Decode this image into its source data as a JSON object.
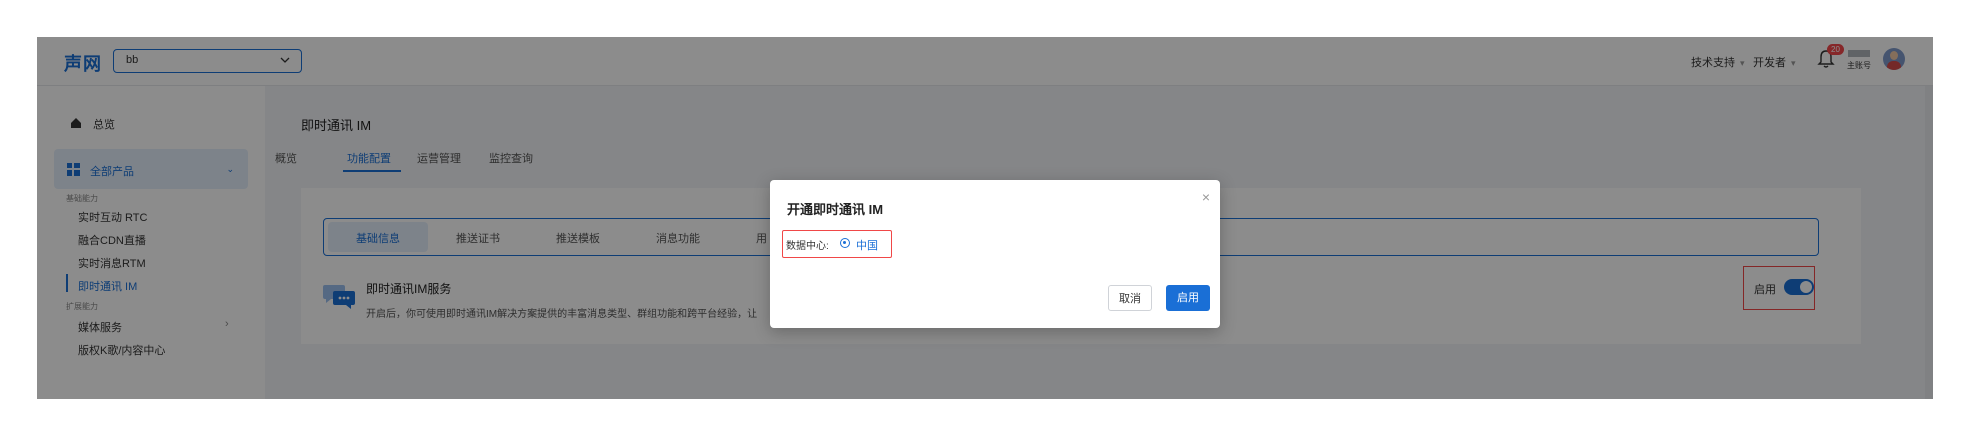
{
  "header": {
    "logo": "声网",
    "project_value": "bb",
    "links": [
      "技术支持",
      "开发者"
    ],
    "notification_count": "20",
    "account_label": "主账号"
  },
  "sidebar": {
    "overview": "总览",
    "all_products": "全部产品",
    "section_basic": "基础能力",
    "basic_items": [
      "实时互动 RTC",
      "融合CDN直播",
      "实时消息RTM",
      "即时通讯 IM"
    ],
    "section_ext": "扩展能力",
    "ext_items": [
      "媒体服务",
      "版权K歌/内容中心"
    ]
  },
  "main": {
    "title": "即时通讯 IM",
    "tabs": [
      "概览",
      "功能配置",
      "运营管理",
      "监控查询"
    ],
    "subtabs": [
      "基础信息",
      "推送证书",
      "推送模板",
      "消息功能",
      "用"
    ],
    "service_title": "即时通讯IM服务",
    "service_desc": "开启后，你可使用即时通讯IM解决方案提供的丰富消息类型、群组功能和跨平台经验，让",
    "toggle_label": "启用",
    "toggle_on": true
  },
  "modal": {
    "title": "开通即时通讯 IM",
    "close": "×",
    "field_label": "数据中心:",
    "option": "中国",
    "cancel": "取消",
    "confirm": "启用"
  },
  "colors": {
    "accent": "#1a6fd6",
    "highlight_border": "#f04747"
  }
}
